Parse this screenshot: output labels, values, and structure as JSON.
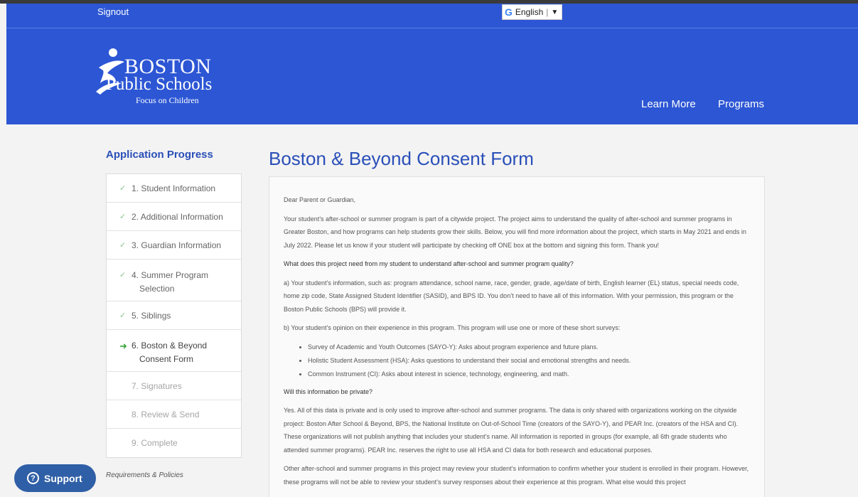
{
  "header": {
    "signout": "Signout",
    "translate": {
      "icon": "google-g-icon",
      "label": "English",
      "arrow": "▼"
    },
    "logo": {
      "line1": "BOSTON",
      "line2": "Public Schools",
      "line3": "Focus on Children"
    },
    "nav": {
      "learn_more": "Learn More",
      "programs": "Programs"
    },
    "color": "#2c56d4"
  },
  "sidebar": {
    "title": "Application Progress",
    "steps": [
      {
        "number": "1.",
        "label": "Student Information",
        "status": "complete"
      },
      {
        "number": "2.",
        "label": "Additional Information",
        "status": "complete"
      },
      {
        "number": "3.",
        "label": "Guardian Information",
        "status": "complete"
      },
      {
        "number": "4.",
        "label": "Summer Program",
        "label2": "Selection",
        "status": "complete"
      },
      {
        "number": "5.",
        "label": "Siblings",
        "status": "complete"
      },
      {
        "number": "6.",
        "label": "Boston & Beyond",
        "label2": "Consent Form",
        "status": "current"
      },
      {
        "number": "7.",
        "label": "Signatures",
        "status": "pending"
      },
      {
        "number": "8.",
        "label": "Review & Send",
        "status": "pending"
      },
      {
        "number": "9.",
        "label": "Complete",
        "status": "pending"
      }
    ],
    "requirements": "Requirements & Policies"
  },
  "support": {
    "label": "Support",
    "icon": "?"
  },
  "main": {
    "title": "Boston & Beyond Consent Form",
    "greeting": "Dear Parent or Guardian,",
    "intro": "Your student’s after-school or summer program is part of a citywide project. The project aims to understand the quality of after-school and summer programs in Greater Boston, and how programs can help students grow their skills. Below, you will find more information about the project, which starts in May 2021 and ends in July 2022. Please let us know if your student will participate by checking off ONE box at the bottom and signing this form. Thank you!",
    "q1": "What does this project need from my student to understand after-school and summer program quality?",
    "a1a": "a) Your student’s information, such as: program attendance, school name, race, gender, grade, age/date of birth, English learner (EL) status, special needs code, home zip code, State Assigned Student Identifier (SASID), and BPS ID. You don’t need to have all of this information. With your permission, this program or the Boston Public Schools (BPS) will provide it.",
    "a1b": "b) Your student’s opinion on their experience in this program. This program will use one or more of these short surveys:",
    "surveys": [
      "Survey of Academic and Youth Outcomes (SAYO-Y): Asks about program experience and future plans.",
      "Holistic Student Assessment (HSA): Asks questions to understand their social and emotional strengths and needs.",
      "Common Instrument (CI): Asks about interest in science, technology, engineering, and math."
    ],
    "q2": "Will this information be private?",
    "a2": "Yes. All of this data is private and is only used to improve after-school and summer programs. The data is only shared with organizations working on the citywide project: Boston After School & Beyond, BPS, the National Institute on Out-of-School Time (creators of the SAYO-Y), and PEAR Inc. (creators of the HSA and CI). These organizations will not publish anything that includes your student’s name. All information is reported in groups (for example, all 6th grade students who attended summer programs). PEAR Inc. reserves the right to use all HSA and CI data for both research and educational purposes.",
    "a3": "Other after-school and summer programs in this project may review your student’s information to confirm whether your student is enrolled in their program. However, these programs will not be able to review your student’s survey responses about their experience at this program. What else would this project"
  }
}
